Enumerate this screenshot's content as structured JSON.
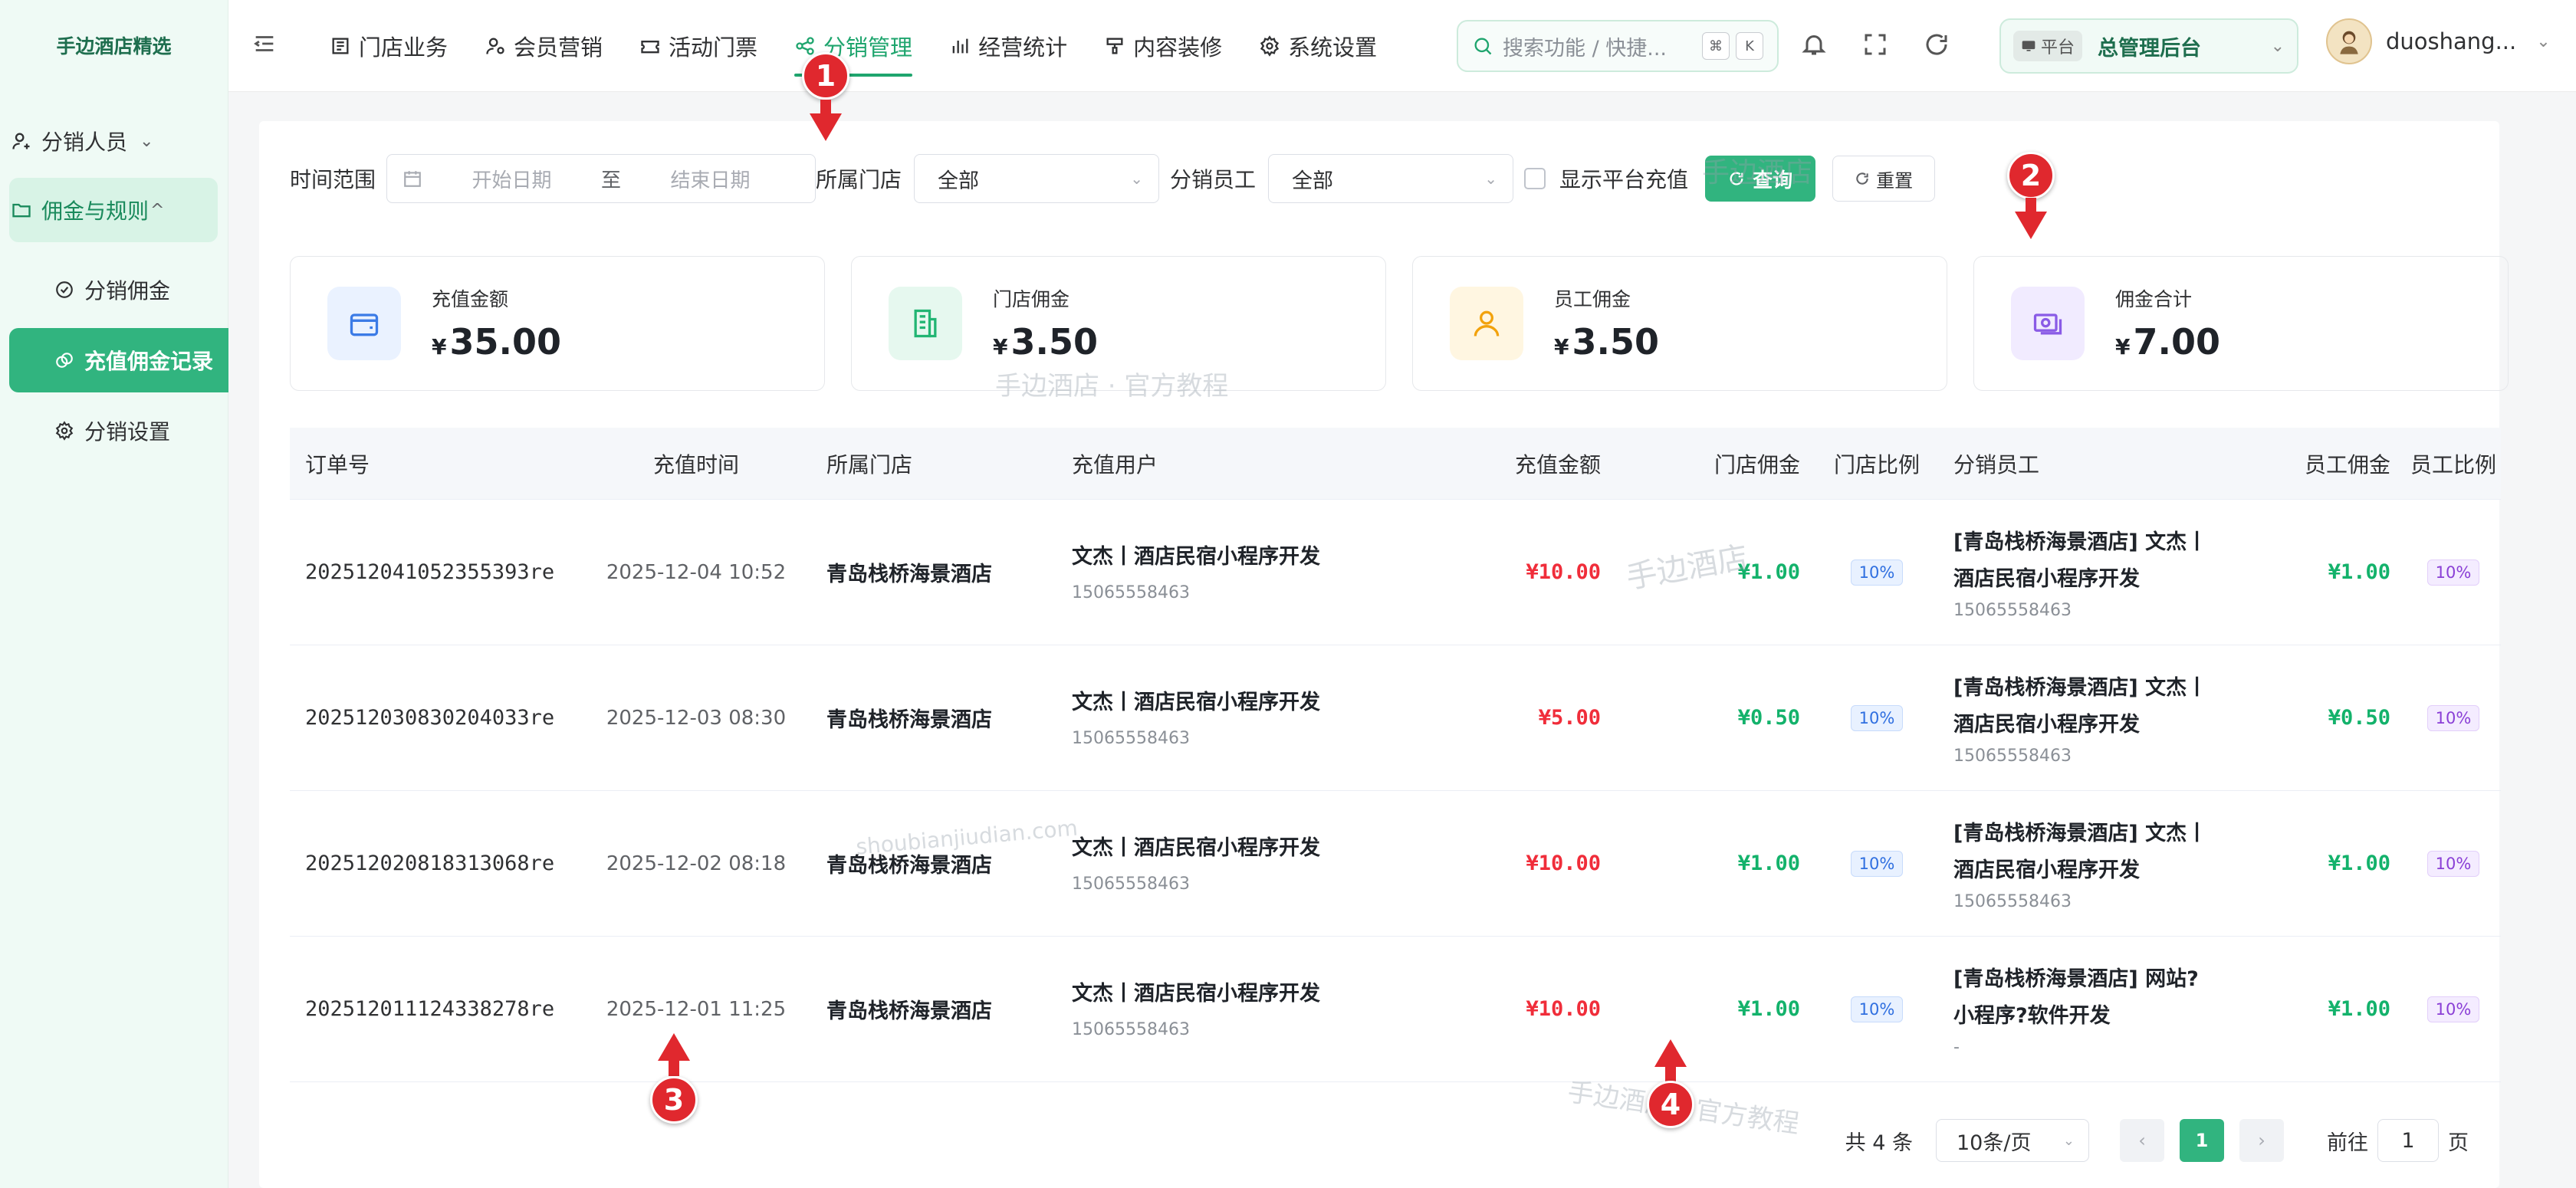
{
  "sidebar": {
    "brand": "手边酒店精选",
    "items": [
      {
        "label": "分销人员"
      },
      {
        "label": "佣金与规则"
      },
      {
        "label": "分销佣金"
      },
      {
        "label": "充值佣金记录"
      },
      {
        "label": "分销设置"
      }
    ]
  },
  "topnav": {
    "items": [
      {
        "label": "门店业务"
      },
      {
        "label": "会员营销"
      },
      {
        "label": "活动门票"
      },
      {
        "label": "分销管理"
      },
      {
        "label": "经营统计"
      },
      {
        "label": "内容装修"
      },
      {
        "label": "系统设置"
      }
    ],
    "active_index": 3,
    "search_placeholder": "搜索功能 / 快捷...",
    "kbd": [
      "⌘",
      "K"
    ],
    "platform_tag": "平台",
    "platform_value": "总管理后台",
    "username": "duoshang..."
  },
  "filters": {
    "time_label": "时间范围",
    "start_placeholder": "开始日期",
    "separator": "至",
    "end_placeholder": "结束日期",
    "store_label": "所属门店",
    "store_value": "全部",
    "staff_label": "分销员工",
    "staff_value": "全部",
    "platform_recharge_label": "显示平台充值",
    "query_button": "查询",
    "reset_button": "重置"
  },
  "summary": [
    {
      "title": "充值金额",
      "currency": "¥",
      "amount": "35.00"
    },
    {
      "title": "门店佣金",
      "currency": "¥",
      "amount": "3.50"
    },
    {
      "title": "员工佣金",
      "currency": "¥",
      "amount": "3.50"
    },
    {
      "title": "佣金合计",
      "currency": "¥",
      "amount": "7.00"
    }
  ],
  "table": {
    "columns": [
      "订单号",
      "充值时间",
      "所属门店",
      "充值用户",
      "充值金额",
      "门店佣金",
      "门店比例",
      "分销员工",
      "员工佣金",
      "员工比例"
    ],
    "rows": [
      {
        "order": "202512041052355393re",
        "time": "2025-12-04 10:52",
        "store": "青岛栈桥海景酒店",
        "user": "文杰丨酒店民宿小程序开发",
        "phone": "15065558463",
        "amount": "¥10.00",
        "store_commission": "¥1.00",
        "store_ratio": "10%",
        "staff_line1": "[青岛栈桥海景酒店] 文杰丨",
        "staff_line2": "酒店民宿小程序开发",
        "staff_phone": "15065558463",
        "staff_commission": "¥1.00",
        "staff_ratio": "10%"
      },
      {
        "order": "202512030830204033re",
        "time": "2025-12-03 08:30",
        "store": "青岛栈桥海景酒店",
        "user": "文杰丨酒店民宿小程序开发",
        "phone": "15065558463",
        "amount": "¥5.00",
        "store_commission": "¥0.50",
        "store_ratio": "10%",
        "staff_line1": "[青岛栈桥海景酒店] 文杰丨",
        "staff_line2": "酒店民宿小程序开发",
        "staff_phone": "15065558463",
        "staff_commission": "¥0.50",
        "staff_ratio": "10%"
      },
      {
        "order": "202512020818313068re",
        "time": "2025-12-02 08:18",
        "store": "青岛栈桥海景酒店",
        "user": "文杰丨酒店民宿小程序开发",
        "phone": "15065558463",
        "amount": "¥10.00",
        "store_commission": "¥1.00",
        "store_ratio": "10%",
        "staff_line1": "[青岛栈桥海景酒店] 文杰丨",
        "staff_line2": "酒店民宿小程序开发",
        "staff_phone": "15065558463",
        "staff_commission": "¥1.00",
        "staff_ratio": "10%"
      },
      {
        "order": "202512011124338278re",
        "time": "2025-12-01 11:25",
        "store": "青岛栈桥海景酒店",
        "user": "文杰丨酒店民宿小程序开发",
        "phone": "15065558463",
        "amount": "¥10.00",
        "store_commission": "¥1.00",
        "store_ratio": "10%",
        "staff_line1": "[青岛栈桥海景酒店] 网站?",
        "staff_line2": "小程序?软件开发",
        "staff_phone": "-",
        "staff_commission": "¥1.00",
        "staff_ratio": "10%"
      }
    ]
  },
  "pagination": {
    "total": "共 4 条",
    "page_size": "10条/页",
    "current": "1",
    "goto_label": "前往",
    "goto_value": "1",
    "page_suffix": "页"
  },
  "watermarks": [
    "手边酒店",
    "手边酒店 · 官方教程",
    "shoubianjiudian.com",
    "手边酒店 · 官方教程"
  ],
  "markers": [
    "1",
    "2",
    "3",
    "4"
  ],
  "colors": {
    "accent": "#31b47f",
    "amount_red": "#f02d3a",
    "commission_green": "#13b26b"
  }
}
